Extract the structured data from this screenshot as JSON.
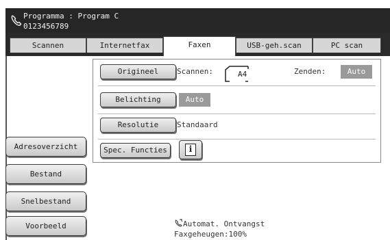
{
  "header": {
    "title": "Programma : Program C",
    "number": "0123456789",
    "icon": "phone-icon"
  },
  "tabs": [
    {
      "label": "Scannen",
      "active": false
    },
    {
      "label": "Internetfax",
      "active": false
    },
    {
      "label": "Faxen",
      "active": true
    },
    {
      "label": "USB-geh.scan",
      "active": false
    },
    {
      "label": "PC scan",
      "active": false
    }
  ],
  "settings": {
    "original_button": "Origineel",
    "scan_label": "Scannen:",
    "scan_size": "A4",
    "send_label": "Zenden:",
    "send_value": "Auto",
    "exposure_button": "Belichting",
    "exposure_value": "Auto",
    "resolution_button": "Resolutie",
    "resolution_value": "Standaard",
    "special_button": "Spec. Functies",
    "info_icon": "i"
  },
  "sidebar": {
    "address_book": "Adresoverzicht",
    "file": "Bestand",
    "quick_file": "Snelbestand",
    "preview": "Voorbeeld"
  },
  "status": {
    "line1": "Automat. Ontvangst",
    "line2": "Faxgeheugen:100%"
  },
  "colors": {
    "header_bg": "#262626",
    "value_box": "#9a9a9a"
  }
}
